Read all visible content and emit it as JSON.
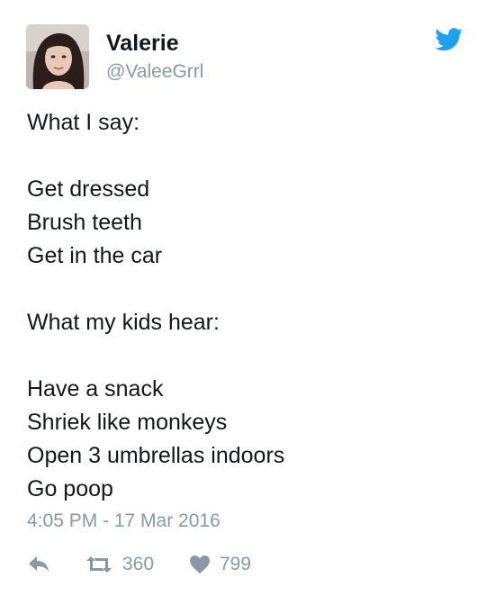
{
  "user": {
    "display_name": "Valerie",
    "handle": "@ValeeGrrl"
  },
  "tweet": {
    "lines": [
      "What I say:",
      "",
      "Get dressed",
      "Brush teeth",
      "Get in the car",
      "",
      "What my kids hear:",
      "",
      "Have a snack",
      "Shriek like monkeys",
      "Open 3 umbrellas indoors",
      "Go poop"
    ],
    "timestamp": "4:05 PM - 17 Mar 2016"
  },
  "actions": {
    "retweet_count": "360",
    "like_count": "799"
  },
  "icons": {
    "brand": "twitter-bird-icon",
    "reply": "reply-arrow-icon",
    "retweet": "retweet-icon",
    "like": "heart-icon"
  },
  "colors": {
    "text": "#14171a",
    "muted": "#8899a6",
    "brand": "#1da1f2"
  }
}
